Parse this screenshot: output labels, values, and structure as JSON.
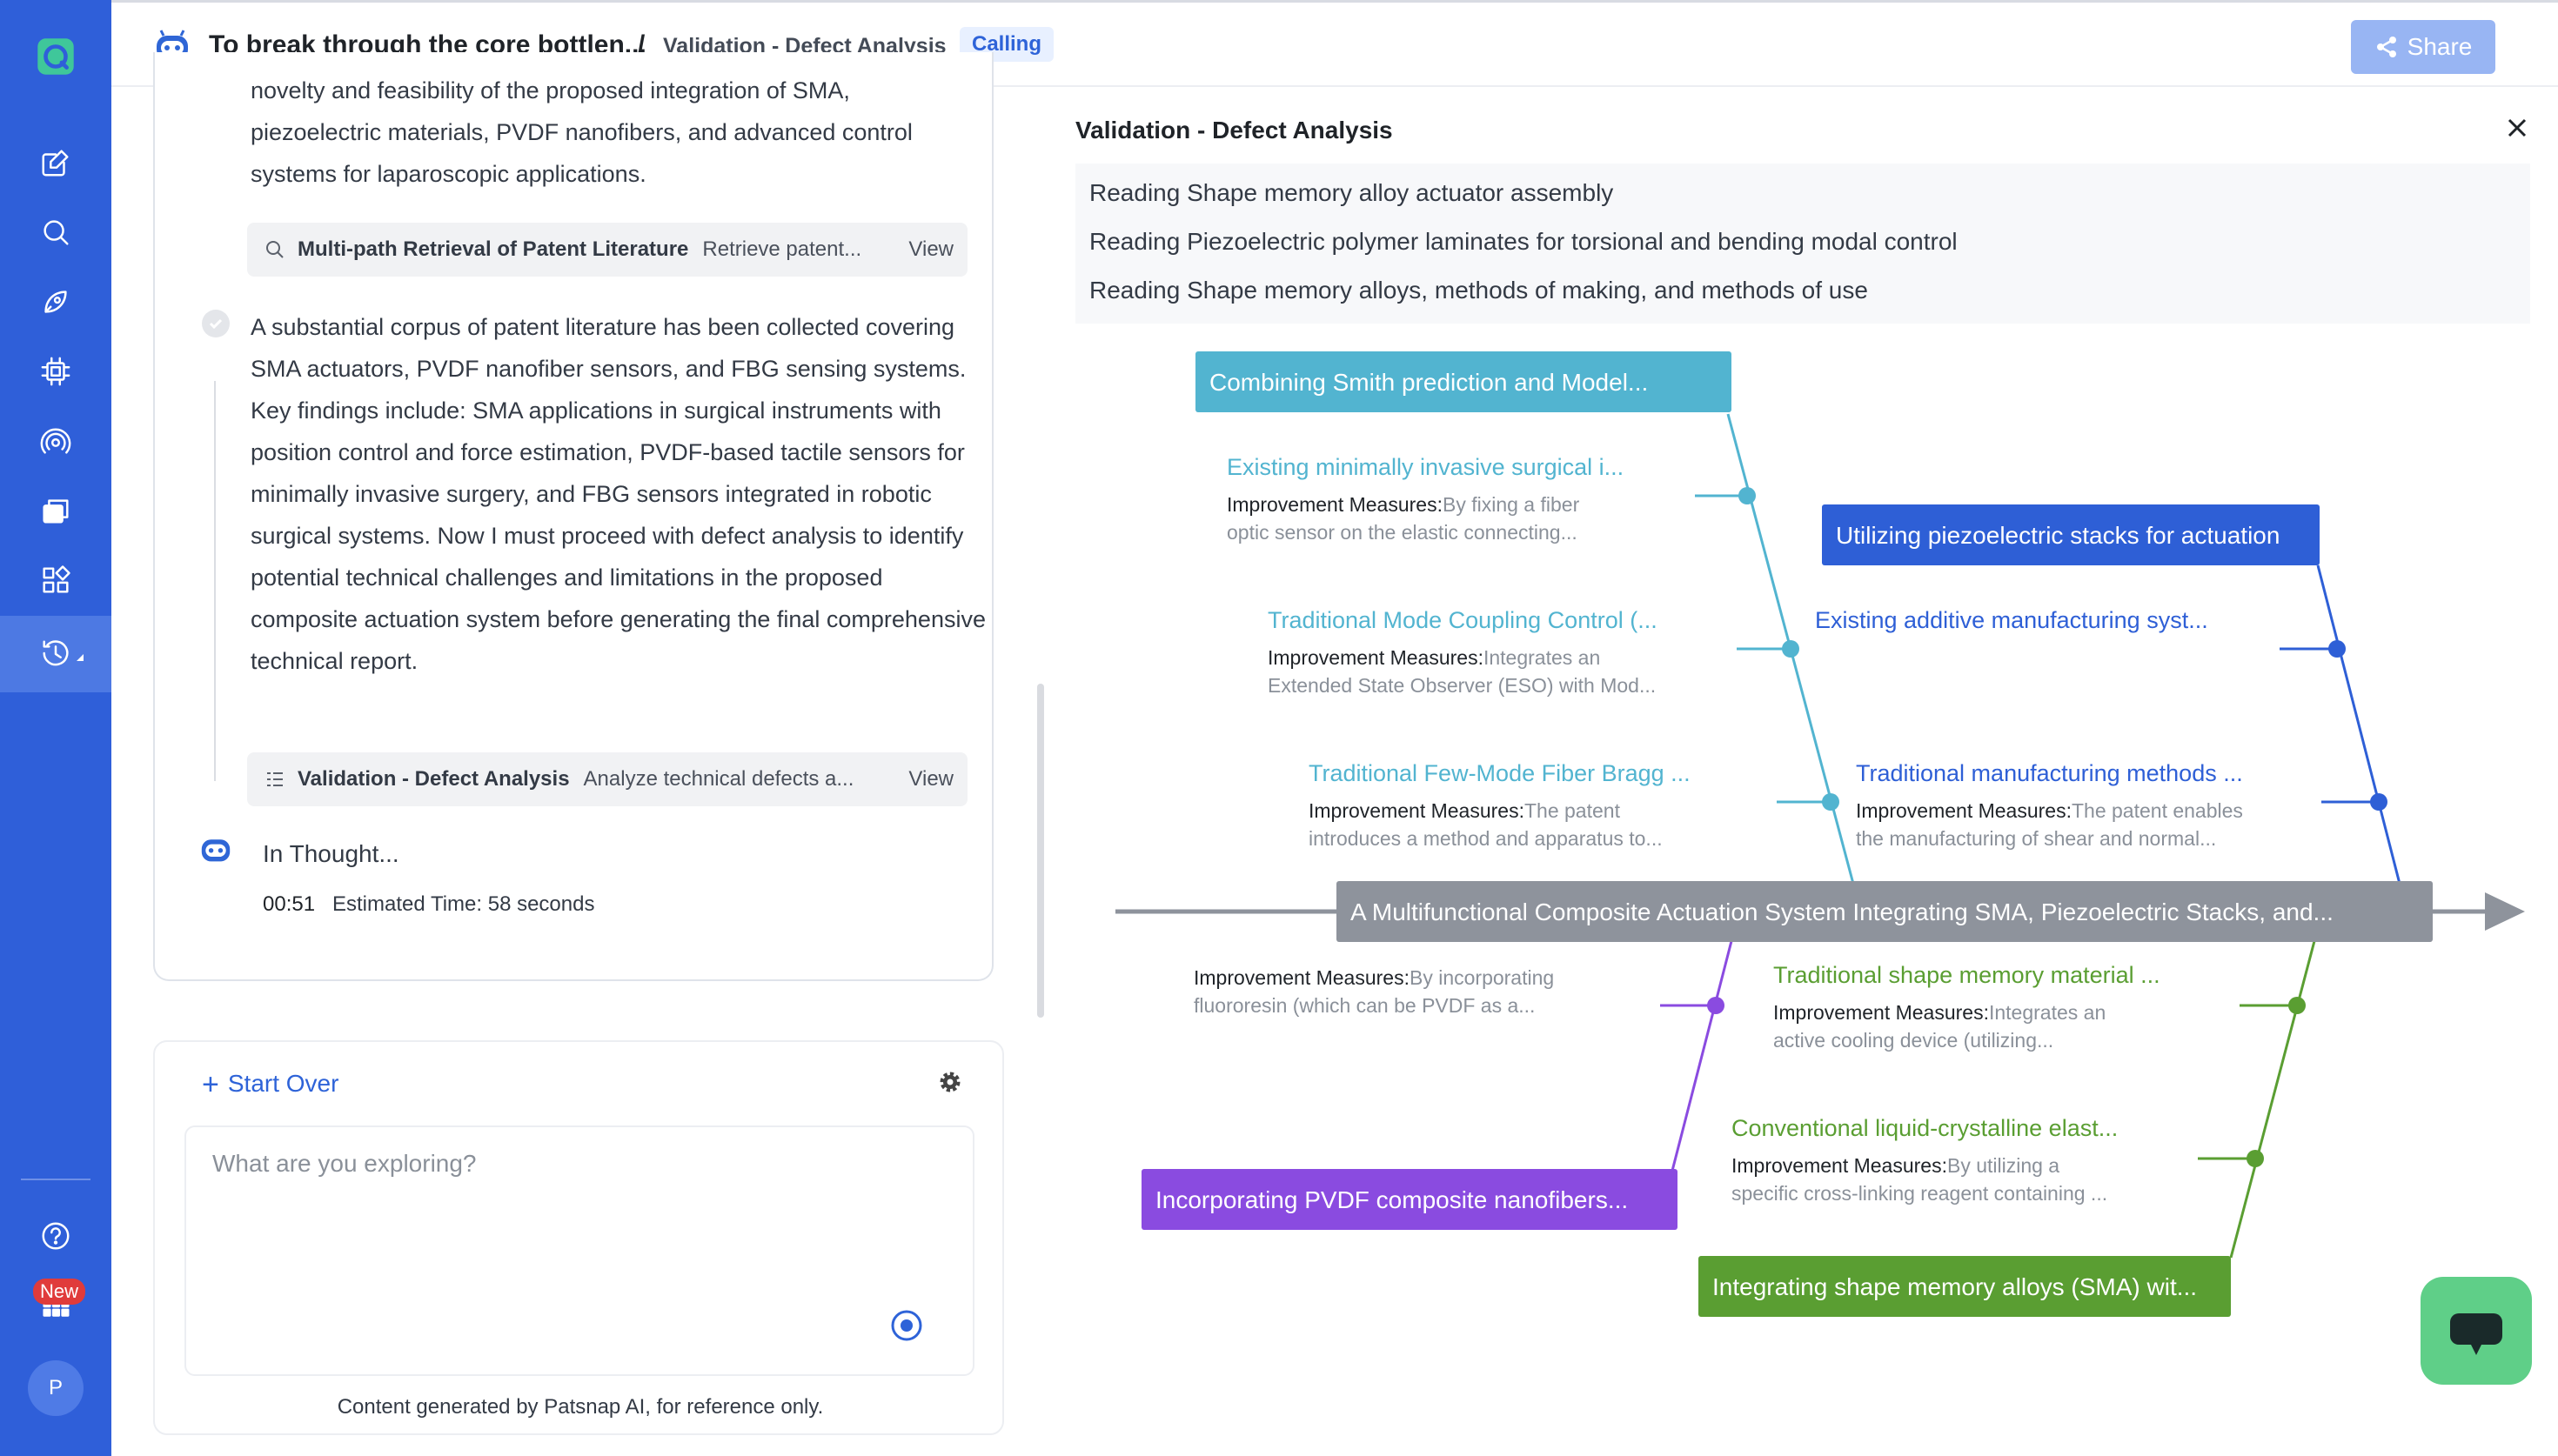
{
  "header": {
    "title": "To break through the core bottlen...",
    "separator": "/",
    "breadcrumb": "Validation - Defect Analysis",
    "status_badge": "Calling",
    "share_label": "Share"
  },
  "sidebar": {
    "items": [
      "new-chat",
      "search",
      "explore",
      "chip",
      "broadcast",
      "files",
      "apps",
      "history"
    ],
    "new_badge": "New",
    "avatar_initial": "P"
  },
  "chat": {
    "intro_text": "novelty and feasibility of the proposed integration of SMA, piezoelectric materials, PVDF nanofibers, and advanced control systems for laparoscopic applications.",
    "tool1": {
      "name": "Multi-path Retrieval of Patent Literature",
      "desc": "Retrieve patent...",
      "view": "View"
    },
    "body_text": "A substantial corpus of patent literature has been collected covering SMA actuators, PVDF nanofiber sensors, and FBG sensing systems. Key findings include: SMA applications in surgical instruments with position control and force estimation, PVDF-based tactile sensors for minimally invasive surgery, and FBG sensors integrated in robotic surgical systems. Now I must proceed with defect analysis to identify potential technical challenges and limitations in the proposed composite actuation system before generating the final comprehensive technical report.",
    "tool2": {
      "name": "Validation - Defect Analysis",
      "desc": "Analyze technical defects a...",
      "view": "View"
    },
    "thinking": "In Thought...",
    "timer": "00:51",
    "estimate": "Estimated Time: 58 seconds"
  },
  "input": {
    "start_over": "Start Over",
    "placeholder": "What are you exploring?",
    "disclaimer": "Content generated by Patsnap AI, for reference only."
  },
  "panel": {
    "title": "Validation - Defect Analysis",
    "reading": [
      "Reading Shape memory alloy actuator assembly",
      "Reading Piezoelectric polymer laminates for torsional and bending modal control",
      "Reading Shape memory alloys, methods of making, and methods of use"
    ]
  },
  "fishbone": {
    "spine_label": "A Multifunctional Composite Actuation System Integrating SMA, Piezoelectric Stacks, and...",
    "measure_label": "Improvement Measures:",
    "colors": {
      "teal": "#52b4d0",
      "blue": "#2e5fd6",
      "purple": "#8a4be0",
      "green": "#5a9e32",
      "spine": "#8e939c"
    },
    "categories": {
      "teal": "Combining Smith prediction and Model...",
      "blue": "Utilizing piezoelectric stacks for actuation",
      "purple": "Incorporating PVDF composite nanofibers...",
      "green": "Integrating shape memory alloys (SMA) wit..."
    },
    "causes": {
      "t1": {
        "title": "Existing minimally invasive surgical i...",
        "text1": "By fixing a fiber",
        "text2": "optic sensor on the elastic connecting..."
      },
      "t2": {
        "title": "Traditional Mode Coupling Control (...",
        "text1": "Integrates an",
        "text2": "Extended State Observer (ESO) with Mod..."
      },
      "t3": {
        "title": "Traditional Few-Mode Fiber Bragg ...",
        "text1": "The patent",
        "text2": "introduces a method and apparatus to..."
      },
      "b1": {
        "title": "Existing additive manufacturing syst..."
      },
      "b2": {
        "title": "Traditional manufacturing methods ...",
        "text1": "The patent enables",
        "text2": "the manufacturing of shear and normal..."
      },
      "p1": {
        "text1": "By incorporating",
        "text2": "fluororesin (which can be PVDF as a..."
      },
      "g1": {
        "title": "Traditional shape memory material ...",
        "text1": "Integrates an",
        "text2": "active cooling device (utilizing..."
      },
      "g2": {
        "title": "Conventional liquid-crystalline elast...",
        "text1": "By utilizing a",
        "text2": "specific cross-linking reagent containing ..."
      }
    }
  }
}
